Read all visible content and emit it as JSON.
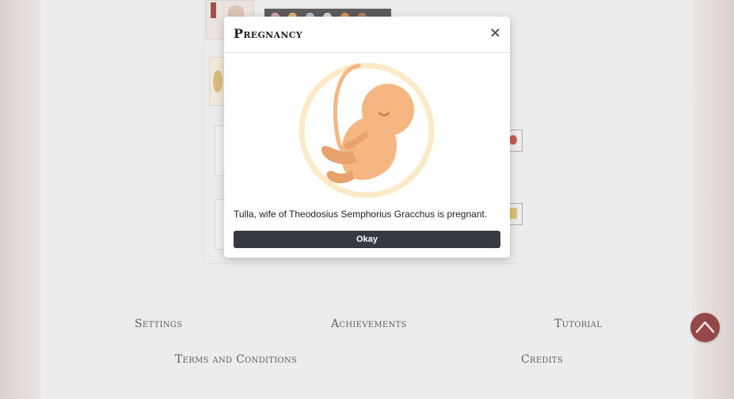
{
  "footer": {
    "settings": "Settings",
    "achievements": "Achievements",
    "tutorial": "Tutorial",
    "terms": "Terms and Conditions",
    "credits": "Credits"
  },
  "modal": {
    "title": "Pregnancy",
    "close_symbol": "×",
    "illustration_icon": "fetus-icon",
    "message": "Tulla, wife of Theodosius Semphorius Gracchus is pregnant.",
    "button_label": "Okay"
  },
  "scroll_top": {
    "icon": "chevron-up-icon"
  },
  "colors": {
    "accent_dark": "#343a40",
    "scroll_button": "#7e1e22",
    "illustration_ring": "#fbe9c7",
    "illustration_body": "#f5b682"
  }
}
